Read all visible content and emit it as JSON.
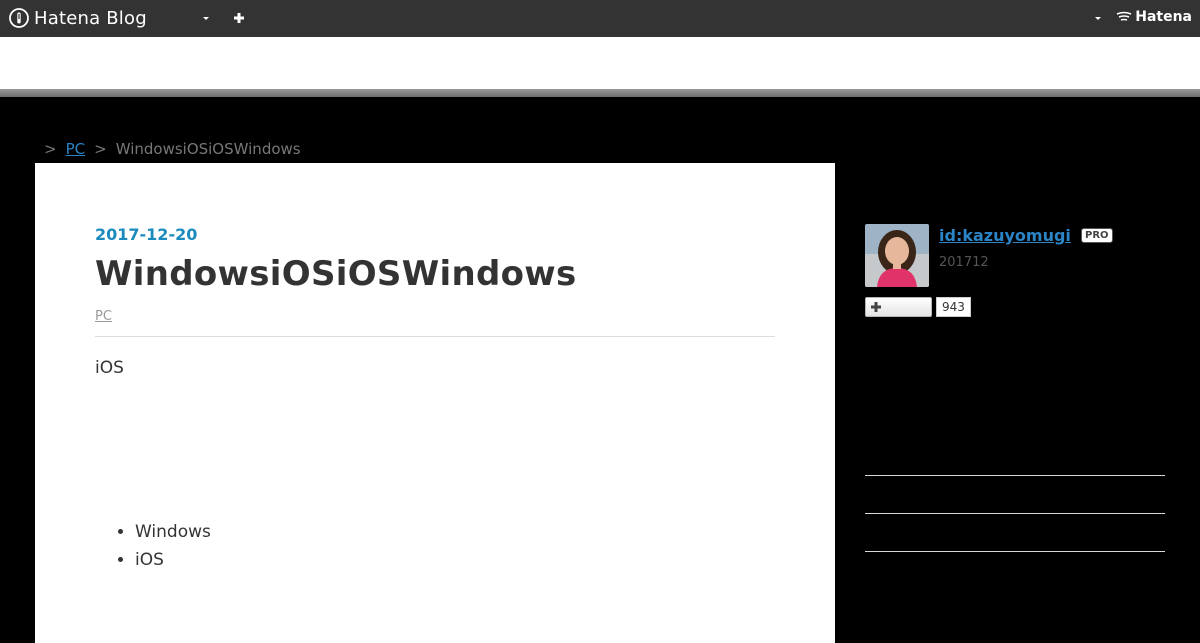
{
  "global_header": {
    "logo_text": "Hatena Blog",
    "hatena_text": "Hatena"
  },
  "breadcrumb": {
    "home_label": " ",
    "separator": ">",
    "category_label": "PC",
    "current_label": "WindowsiOSiOSWindows"
  },
  "entry": {
    "date": "2017-12-20",
    "title": "WindowsiOSiOSWindows",
    "category": "PC",
    "paragraph": "iOS",
    "list_items": [
      "Windows",
      "iOS"
    ]
  },
  "sidebar": {
    "profile_id": "id:kazuyomugi",
    "pro_badge": "PRO",
    "since": "201712",
    "follow_count": "943"
  },
  "colors": {
    "header_bg": "#333333",
    "page_bg": "#000000",
    "link": "#2a84c6",
    "date": "#1b8bbd"
  }
}
